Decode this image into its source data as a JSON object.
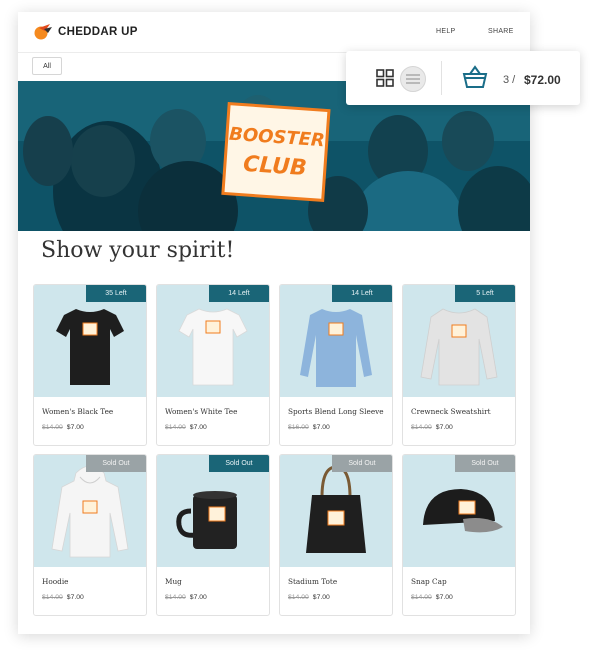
{
  "brand": {
    "name": "CHEDDAR UP"
  },
  "nav": {
    "help": "HELP",
    "share": "SHARE"
  },
  "filter": {
    "selected": "All"
  },
  "hero": {
    "sign_line1": "BOOSTER",
    "sign_line2": "CLUB"
  },
  "heading": "Show your spirit!",
  "cart": {
    "count": "3 /",
    "total": "$72.00"
  },
  "products": [
    {
      "name": "Women's Black Tee",
      "old_price": "$14.00",
      "price": "$7.00",
      "badge": "35 Left",
      "badge_type": "left"
    },
    {
      "name": "Women's White Tee",
      "old_price": "$14.00",
      "price": "$7.00",
      "badge": "14 Left",
      "badge_type": "left"
    },
    {
      "name": "Sports Blend Long Sleeve",
      "old_price": "$16.00",
      "price": "$7.00",
      "badge": "14 Left",
      "badge_type": "left"
    },
    {
      "name": "Crewneck Sweatshirt",
      "old_price": "$14.00",
      "price": "$7.00",
      "badge": "5 Left",
      "badge_type": "left"
    },
    {
      "name": "Hoodie",
      "old_price": "$14.00",
      "price": "$7.00",
      "badge": "Sold Out",
      "badge_type": "out"
    },
    {
      "name": "Mug",
      "old_price": "$14.00",
      "price": "$7.00",
      "badge": "Sold Out",
      "badge_type": "out-teal"
    },
    {
      "name": "Stadium Tote",
      "old_price": "$14.00",
      "price": "$7.00",
      "badge": "Sold Out",
      "badge_type": "out"
    },
    {
      "name": "Snap Cap",
      "old_price": "$14.00",
      "price": "$7.00",
      "badge": "Sold Out",
      "badge_type": "out"
    }
  ],
  "icons": {
    "logo": "cheddar-logo-icon",
    "grid_view": "grid-view-icon",
    "list_view": "list-view-icon",
    "cart": "basket-icon"
  },
  "colors": {
    "accent_teal": "#1a6577",
    "card_bg": "#cfe6ec",
    "sign_orange": "#f07c1e"
  }
}
